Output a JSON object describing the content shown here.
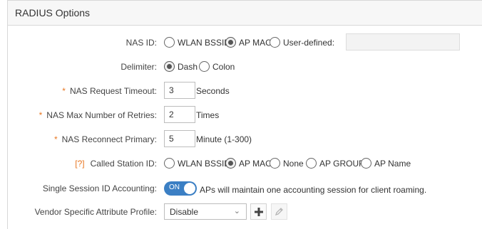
{
  "header": {
    "title": "RADIUS Options"
  },
  "nas_id": {
    "label": "NAS ID:",
    "options": [
      "WLAN BSSID",
      "AP MAC",
      "User-defined:"
    ],
    "selected": "AP MAC",
    "user_defined_value": ""
  },
  "delimiter": {
    "label": "Delimiter:",
    "options": [
      "Dash",
      "Colon"
    ],
    "selected": "Dash"
  },
  "nas_request_timeout": {
    "required_mark": "*",
    "label": "NAS Request Timeout:",
    "value": "3",
    "unit": "Seconds"
  },
  "nas_max_retries": {
    "required_mark": "*",
    "label": "NAS Max Number of Retries:",
    "value": "2",
    "unit": "Times"
  },
  "nas_reconnect_primary": {
    "required_mark": "*",
    "label": "NAS Reconnect Primary:",
    "value": "5",
    "unit": "Minute (1-300)"
  },
  "called_station_id": {
    "hint": "[?]",
    "label": "Called Station ID:",
    "options": [
      "WLAN BSSID",
      "AP MAC",
      "None",
      "AP GROUP",
      "AP Name"
    ],
    "selected": "AP MAC"
  },
  "single_session": {
    "label": "Single Session ID Accounting:",
    "toggle_text": "ON",
    "toggle_on": true,
    "description": "APs will maintain one accounting session for client roaming."
  },
  "vendor_profile": {
    "label": "Vendor Specific Attribute Profile:",
    "selected": "Disable",
    "add_icon": "plus-icon",
    "edit_icon": "pencil-icon"
  },
  "colors": {
    "accent": "#3b7fc4",
    "required": "#e87722"
  }
}
